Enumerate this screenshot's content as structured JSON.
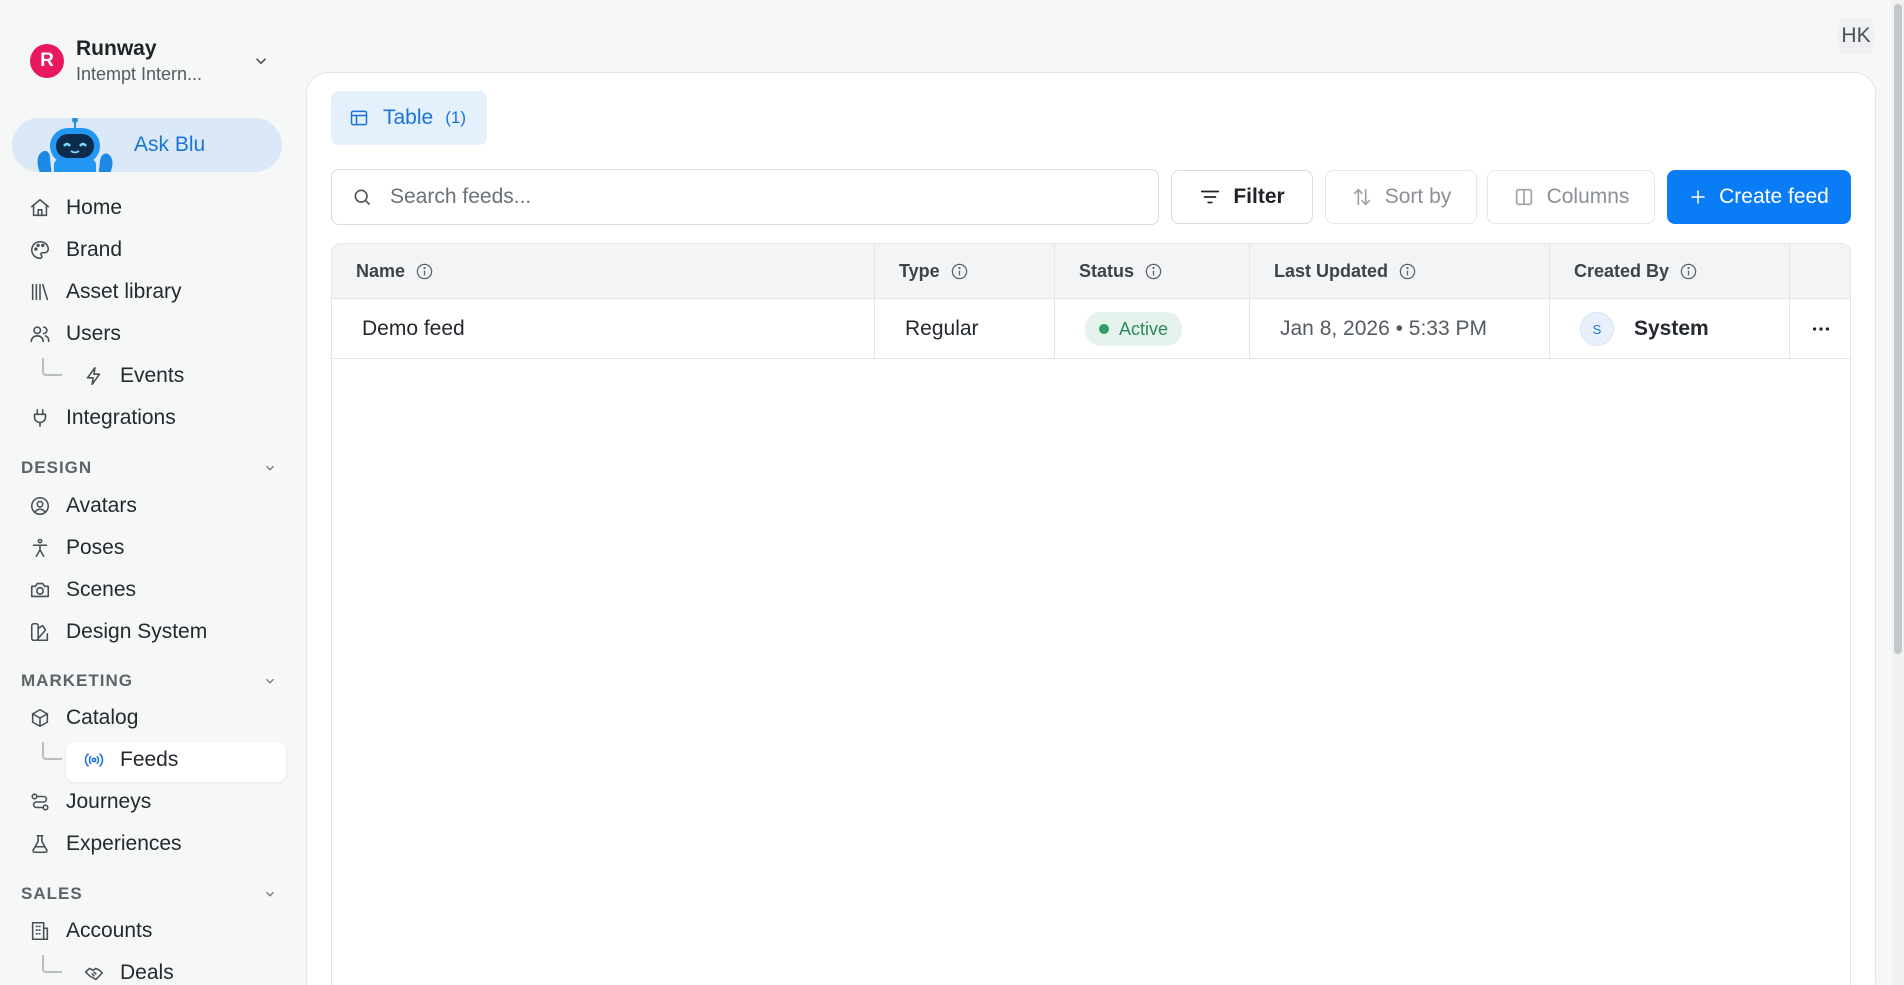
{
  "org": {
    "initial": "R",
    "name": "Runway",
    "subtitle": "Intempt Intern..."
  },
  "ask_blu": {
    "label": "Ask Blu"
  },
  "nav": {
    "home": "Home",
    "brand": "Brand",
    "asset_library": "Asset library",
    "users": "Users",
    "events": "Events",
    "integrations": "Integrations"
  },
  "sections": {
    "design": {
      "title": "DESIGN",
      "items": {
        "avatars": "Avatars",
        "poses": "Poses",
        "scenes": "Scenes",
        "design_system": "Design System"
      }
    },
    "marketing": {
      "title": "MARKETING",
      "items": {
        "catalog": "Catalog",
        "feeds": "Feeds",
        "journeys": "Journeys",
        "experiences": "Experiences"
      }
    },
    "sales": {
      "title": "SALES",
      "items": {
        "accounts": "Accounts",
        "deals": "Deals"
      }
    }
  },
  "user": {
    "initials": "HK"
  },
  "view_tab": {
    "label": "Table",
    "count": "(1)"
  },
  "search": {
    "placeholder": "Search feeds...",
    "value": ""
  },
  "toolbar": {
    "filter": "Filter",
    "sort": "Sort by",
    "columns": "Columns",
    "create": "Create feed"
  },
  "table": {
    "columns": [
      "Name",
      "Type",
      "Status",
      "Last Updated",
      "Created By"
    ],
    "rows": [
      {
        "name": "Demo feed",
        "type": "Regular",
        "status": "Active",
        "last_updated": "Jan 8, 2026 • 5:33 PM",
        "creator_initial": "S",
        "created_by": "System"
      }
    ]
  },
  "colors": {
    "accent": "#0a7cf5",
    "org_avatar": "#e8195f",
    "active_status": "#2f9e63",
    "tab_bg": "#e4f0fb"
  },
  "icons": {
    "home": "home-icon",
    "brand": "palette-icon",
    "asset_library": "library-icon",
    "users": "users-icon",
    "events": "zap-icon",
    "integrations": "plug-icon",
    "avatars": "user-circle-icon",
    "poses": "figure-icon",
    "scenes": "camera-icon",
    "design_system": "swatch-icon",
    "catalog": "box-icon",
    "feeds": "broadcast-icon",
    "journeys": "route-icon",
    "experiences": "flask-icon",
    "accounts": "building-icon",
    "deals": "handshake-icon"
  }
}
